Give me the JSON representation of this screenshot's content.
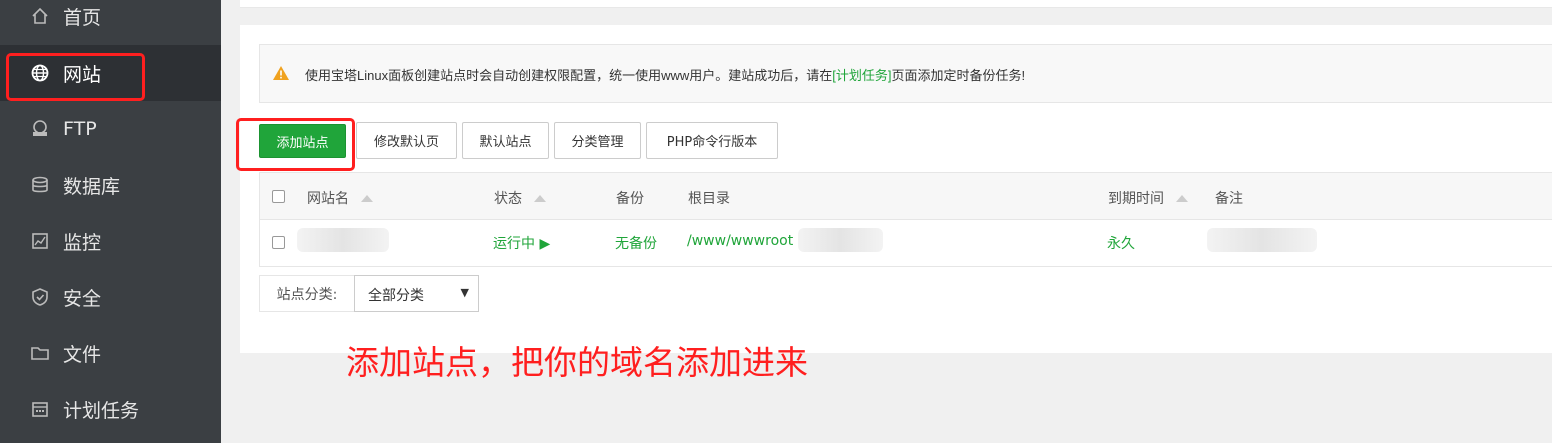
{
  "sidebar": {
    "items": [
      {
        "label": "首页",
        "icon": "home-icon"
      },
      {
        "label": "网站",
        "icon": "globe-icon",
        "active": true
      },
      {
        "label": "FTP",
        "icon": "ftp-icon"
      },
      {
        "label": "数据库",
        "icon": "database-icon"
      },
      {
        "label": "监控",
        "icon": "monitor-icon"
      },
      {
        "label": "安全",
        "icon": "shield-icon"
      },
      {
        "label": "文件",
        "icon": "folder-icon"
      },
      {
        "label": "计划任务",
        "icon": "calendar-icon"
      }
    ]
  },
  "notice": {
    "text_before": "使用宝塔Linux面板创建站点时会自动创建权限配置，统一使用www用户。建站成功后，请在",
    "link": "[计划任务]",
    "text_after": "页面添加定时备份任务!"
  },
  "toolbar": {
    "add_site": "添加站点",
    "modify_default_page": "修改默认页",
    "default_site": "默认站点",
    "category_manage": "分类管理",
    "php_cli_version": "PHP命令行版本"
  },
  "table": {
    "headers": {
      "site_name": "网站名",
      "status": "状态",
      "backup": "备份",
      "root_dir": "根目录",
      "expire": "到期时间",
      "remark": "备注"
    },
    "rows": [
      {
        "status": "运行中 ▶",
        "backup": "无备份",
        "root_dir": "/www/wwwroot",
        "expire": "永久"
      }
    ]
  },
  "filter": {
    "label": "站点分类:",
    "selected": "全部分类"
  },
  "annotation": "添加站点，把你的域名添加进来",
  "colors": {
    "accent": "#20a53a",
    "highlight": "#ff1f1f",
    "sidebar_bg": "#3b3f43"
  }
}
